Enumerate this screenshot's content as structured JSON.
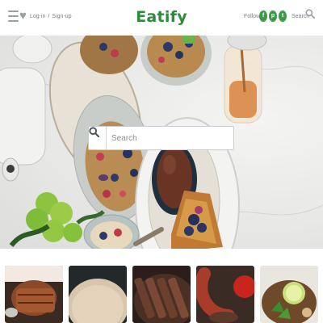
{
  "header": {
    "brand": "Eatify",
    "login_label": "Log-in",
    "separator": "/",
    "signup_label": "Sign-up",
    "follow_label": "Follow",
    "search_label": "Search",
    "brand_color": "#2e8b3e",
    "social_icons": [
      "facebook-icon",
      "pinterest-icon",
      "twitter-icon"
    ]
  },
  "hero": {
    "search_placeholder": "Search"
  },
  "thumbnails": [
    {
      "subject": "grilled-meat"
    },
    {
      "subject": "creamy-soup"
    },
    {
      "subject": "sliced-steak"
    },
    {
      "subject": "sausage-and-tomato"
    },
    {
      "subject": "taco-with-lime"
    }
  ]
}
